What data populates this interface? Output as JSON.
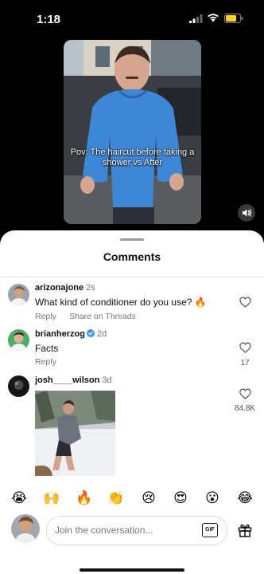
{
  "status": {
    "time": "1:18"
  },
  "video": {
    "caption": "Pov: The haircut before taking a shower vs After"
  },
  "comments_sheet": {
    "title": "Comments",
    "comments": [
      {
        "user": "arizonajone",
        "time": "2s",
        "text": "What kind of conditioner do you use? 🔥",
        "reply": "Reply",
        "share": "Share on Threads"
      },
      {
        "user": "brianherzog",
        "time": "2d",
        "text": "Facts",
        "reply": "Reply",
        "likes": "17"
      },
      {
        "user": "josh____wilson",
        "time": "3d",
        "likes": "84.8K"
      }
    ]
  },
  "emoji_bar": [
    "😭",
    "🙌",
    "🔥",
    "👏",
    "😢",
    "😍",
    "😮",
    "😂"
  ],
  "composer": {
    "placeholder": "Join the conversation...",
    "gif_label": "GIF"
  }
}
